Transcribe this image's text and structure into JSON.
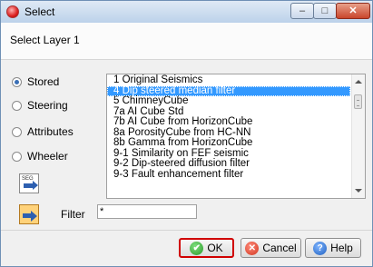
{
  "window": {
    "title": "Select"
  },
  "header": {
    "label": "Select Layer 1"
  },
  "source_options": [
    {
      "label": "Stored",
      "checked": true
    },
    {
      "label": "Steering",
      "checked": false
    },
    {
      "label": "Attributes",
      "checked": false
    },
    {
      "label": "Wheeler",
      "checked": false
    }
  ],
  "list": {
    "items": [
      "1 Original Seismics",
      "4 Dip steered median filter",
      "5 ChimneyCube",
      "7a AI Cube Std",
      "7b AI Cube from HorizonCube",
      "8a PorosityCube from HC-NN",
      "8b Gamma from HorizonCube",
      "9-1 Similarity on FEF seismic",
      "9-2 Dip-steered diffusion filter",
      "9-3 Fault enhancement filter"
    ],
    "selected_index": 1
  },
  "filter": {
    "label": "Filter",
    "value": "*"
  },
  "buttons": {
    "ok": "OK",
    "cancel": "Cancel",
    "help": "Help"
  },
  "icons": {
    "app": "select-app-icon",
    "sec": "sec-import-icon",
    "filter": "filter-arrow-icon"
  }
}
